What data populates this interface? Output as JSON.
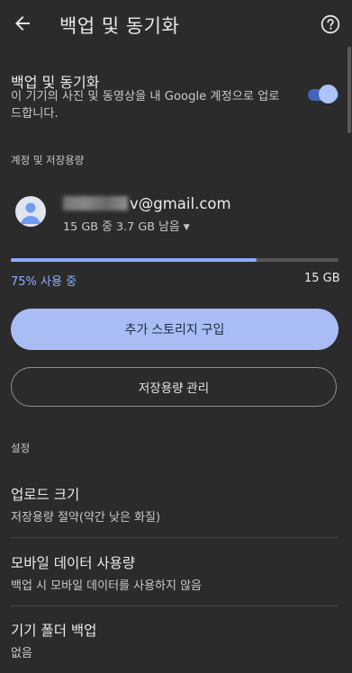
{
  "appbar": {
    "title": "백업 및 동기화",
    "back_icon": "arrow-back-icon",
    "help_icon": "help-circle-icon"
  },
  "backup": {
    "title": "백업 및 동기화",
    "description": "이 기기의 사진 및 동영상을 내 Google 계정으로 업로드합니다.",
    "toggle_on": true
  },
  "account": {
    "section_label": "계정 및 저장용량",
    "email_visible": "v@gmail.com",
    "quota": "15 GB 중 3.7 GB 남음"
  },
  "storage": {
    "used_fraction": 0.75,
    "usage_label": "75% 사용 중",
    "total_label": "15 GB",
    "buy_button": "추가 스토리지 구입",
    "manage_button": "저장용량 관리"
  },
  "settings": {
    "section_label": "설정",
    "items": [
      {
        "title": "업로드 크기",
        "subtitle": "저장용량 절약(약간 낮은 화질)"
      },
      {
        "title": "모바일 데이터 사용량",
        "subtitle": "백업 시 모바일 데이터를 사용하지 않음"
      },
      {
        "title": "기기 폴더 백업",
        "subtitle": "없음"
      }
    ]
  },
  "colors": {
    "background": "#2b2b2b",
    "accent": "#8aabff",
    "button_fill": "#a9bdf4"
  }
}
